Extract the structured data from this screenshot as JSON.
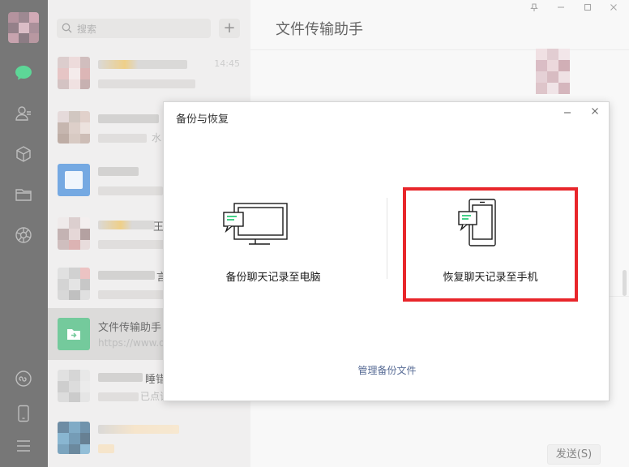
{
  "search": {
    "placeholder": "搜索"
  },
  "new_chat": {
    "label": "+"
  },
  "chats": [
    {
      "time": "14:45"
    },
    {
      "preview_tail": "水"
    },
    {},
    {
      "name_tail": "王"
    },
    {
      "name_tail": "言"
    },
    {
      "name": "文件传输助手",
      "preview": "https://www.d"
    },
    {
      "name_tail": "睡错",
      "preview_tail": "已点该"
    },
    {}
  ],
  "chat_header": {
    "title": "文件传输助手"
  },
  "send_button": {
    "label": "发送(S)"
  },
  "dialog": {
    "title": "备份与恢复",
    "backup_label": "备份聊天记录至电脑",
    "restore_label": "恢复聊天记录至手机",
    "manage_label": "管理备份文件"
  },
  "colors": {
    "wechat_green": "#07c160",
    "highlight_red": "#e8262b",
    "link_blue": "#576b95"
  }
}
